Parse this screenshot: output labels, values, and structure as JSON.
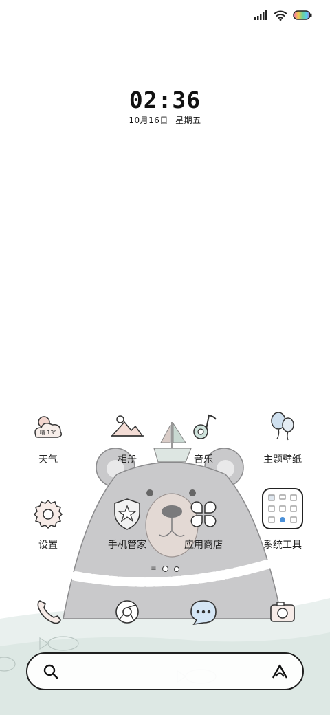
{
  "status_bar": {
    "signal_icon": "signal-bars-icon",
    "wifi_icon": "wifi-icon",
    "battery_icon": "battery-icon"
  },
  "clock": {
    "time": "02:36",
    "date": "10月16日 星期五"
  },
  "apps": [
    {
      "label": "天气",
      "icon": "weather-icon",
      "weather_text": "晴 13°"
    },
    {
      "label": "相册",
      "icon": "gallery-icon"
    },
    {
      "label": "音乐",
      "icon": "music-icon"
    },
    {
      "label": "主题壁纸",
      "icon": "themes-icon"
    },
    {
      "label": "设置",
      "icon": "settings-icon"
    },
    {
      "label": "手机管家",
      "icon": "security-icon"
    },
    {
      "label": "应用商店",
      "icon": "app-store-icon"
    },
    {
      "label": "系统工具",
      "icon": "system-tools-folder-icon"
    }
  ],
  "page_indicator": {
    "pages": 2,
    "active": 1
  },
  "dock": [
    {
      "icon": "phone-icon"
    },
    {
      "icon": "browser-icon"
    },
    {
      "icon": "messages-icon"
    },
    {
      "icon": "camera-icon"
    }
  ],
  "search_bar": {
    "search_icon": "search-icon",
    "assistant_icon": "assistant-icon"
  },
  "colors": {
    "bear_gray": "#c9c9cb",
    "bear_outline": "#7a7a7c",
    "water": "#e7efec",
    "muzzle": "#e3d9d4"
  }
}
